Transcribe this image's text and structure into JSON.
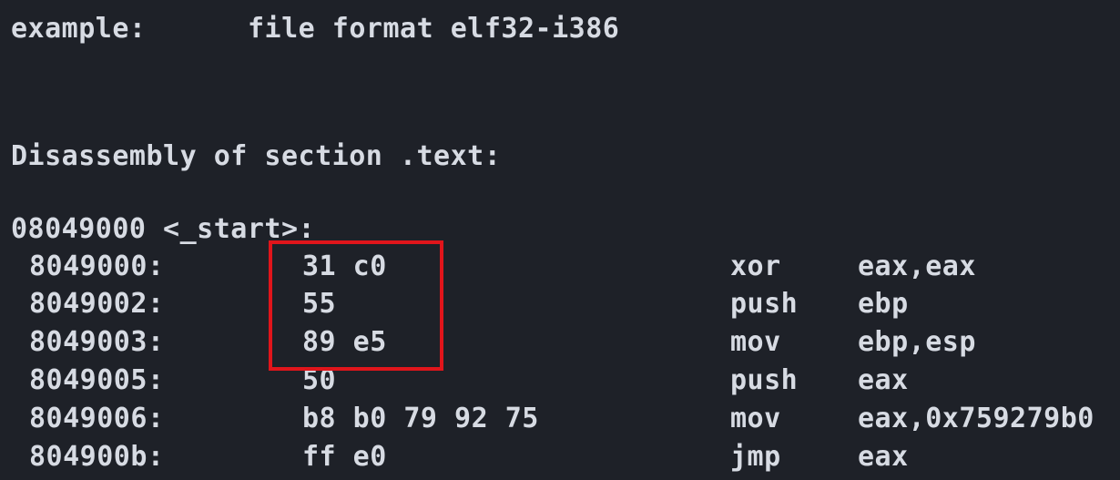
{
  "header": {
    "name": "example:",
    "format": "file format elf32-i386"
  },
  "section_title": "Disassembly of section .text:",
  "symbol": "08049000 <_start>:",
  "rows": [
    {
      "address": "8049000:",
      "bytes": "31 c0",
      "mnemonic": "xor",
      "operands": "eax,eax"
    },
    {
      "address": "8049002:",
      "bytes": "55",
      "mnemonic": "push",
      "operands": "ebp"
    },
    {
      "address": "8049003:",
      "bytes": "89 e5",
      "mnemonic": "mov",
      "operands": "ebp,esp"
    },
    {
      "address": "8049005:",
      "bytes": "50",
      "mnemonic": "push",
      "operands": "eax"
    },
    {
      "address": "8049006:",
      "bytes": "b8 b0 79 92 75",
      "mnemonic": "mov",
      "operands": "eax,0x759279b0"
    },
    {
      "address": "804900b:",
      "bytes": "ff e0",
      "mnemonic": "jmp",
      "operands": "eax"
    }
  ],
  "colors": {
    "background": "#1e2128",
    "text": "#d7dbe3",
    "highlight": "#e0151b"
  }
}
